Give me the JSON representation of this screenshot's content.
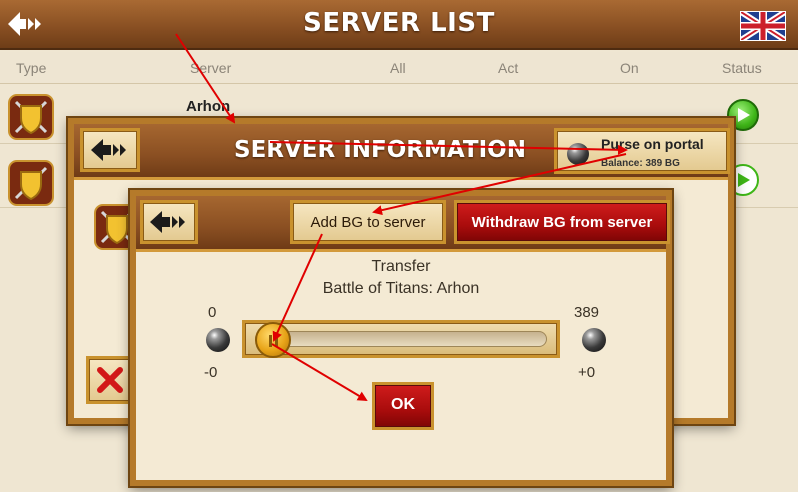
{
  "app": {
    "title": "SERVER LIST",
    "back_icon": "back-arrow-icon",
    "language_flag": "uk-flag-icon"
  },
  "table": {
    "columns": [
      "Type",
      "Server",
      "All",
      "Act",
      "On",
      "Status"
    ],
    "rows": [
      {
        "server": "Arhon",
        "icon": "shield-swords-icon",
        "status": "online"
      },
      {
        "icon": "shield-spear-icon",
        "status": "online"
      }
    ]
  },
  "server_info": {
    "title": "SERVER INFORMATION",
    "back_icon": "back-arrow-icon",
    "purse_button": {
      "label": "Purse on portal",
      "balance": "Balance: 389 BG",
      "icon": "coin-ball-icon"
    },
    "close_icon": "close-x-icon"
  },
  "transfer_dialog": {
    "back_icon": "back-arrow-icon",
    "add_tab": "Add BG to server",
    "withdraw_tab": "Withdraw BG from server",
    "heading": "Transfer",
    "subheading": "Battle of Titans: Arhon",
    "slider": {
      "min_label": "0",
      "max_label": "389",
      "left_delta": "-0",
      "right_delta": "+0",
      "value": 0
    },
    "ok_label": "OK"
  },
  "colors": {
    "wood_header": "#8a5023",
    "gold_frame": "#c9922e",
    "red_button": "#b00f0f",
    "parchment": "#f4ead4",
    "annotation_arrow": "#e00000",
    "status_green": "#3fb618"
  }
}
